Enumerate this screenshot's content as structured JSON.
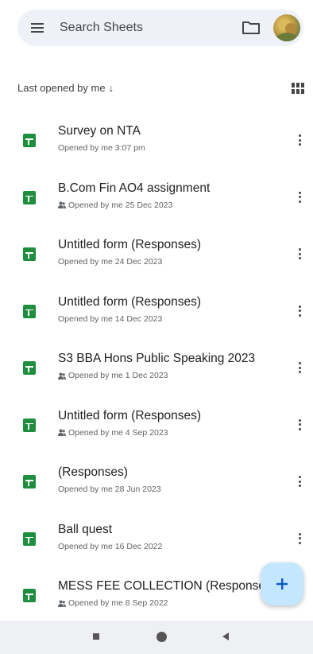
{
  "search": {
    "placeholder": "Search Sheets"
  },
  "sort": {
    "label": "Last opened by me",
    "direction_icon": "arrow-down-icon"
  },
  "files": [
    {
      "title": "Survey on NTA",
      "subtitle": "Opened by me 3:07 pm",
      "shared": false
    },
    {
      "title": "B.Com Fin AO4 assignment",
      "subtitle": "Opened by me 25 Dec 2023",
      "shared": true
    },
    {
      "title": "Untitled form (Responses)",
      "subtitle": "Opened by me 24 Dec 2023",
      "shared": false
    },
    {
      "title": "Untitled form (Responses)",
      "subtitle": "Opened by me 14 Dec 2023",
      "shared": false
    },
    {
      "title": "S3 BBA Hons Public Speaking 2023",
      "subtitle": "Opened by me 1 Dec 2023",
      "shared": true
    },
    {
      "title": "Untitled form (Responses)",
      "subtitle": "Opened by me 4 Sep 2023",
      "shared": true
    },
    {
      "title": " (Responses)",
      "subtitle": "Opened by me 28 Jun 2023",
      "shared": false
    },
    {
      "title": "Ball quest",
      "subtitle": "Opened by me 16 Dec 2022",
      "shared": false
    },
    {
      "title": "MESS FEE COLLECTION (Responses)",
      "subtitle": "Opened by me 8 Sep 2022",
      "shared": true
    }
  ],
  "colors": {
    "sheets_green": "#1e8e3e",
    "search_bg": "#eef2f8",
    "fab_bg": "#c2e7ff",
    "nav_bg": "#eef0f3"
  },
  "icons": {
    "menu": "menu-icon",
    "folder": "folder-icon",
    "grid": "grid-view-icon",
    "more": "more-vert-icon",
    "add": "plus-icon",
    "shared": "shared-people-icon"
  }
}
